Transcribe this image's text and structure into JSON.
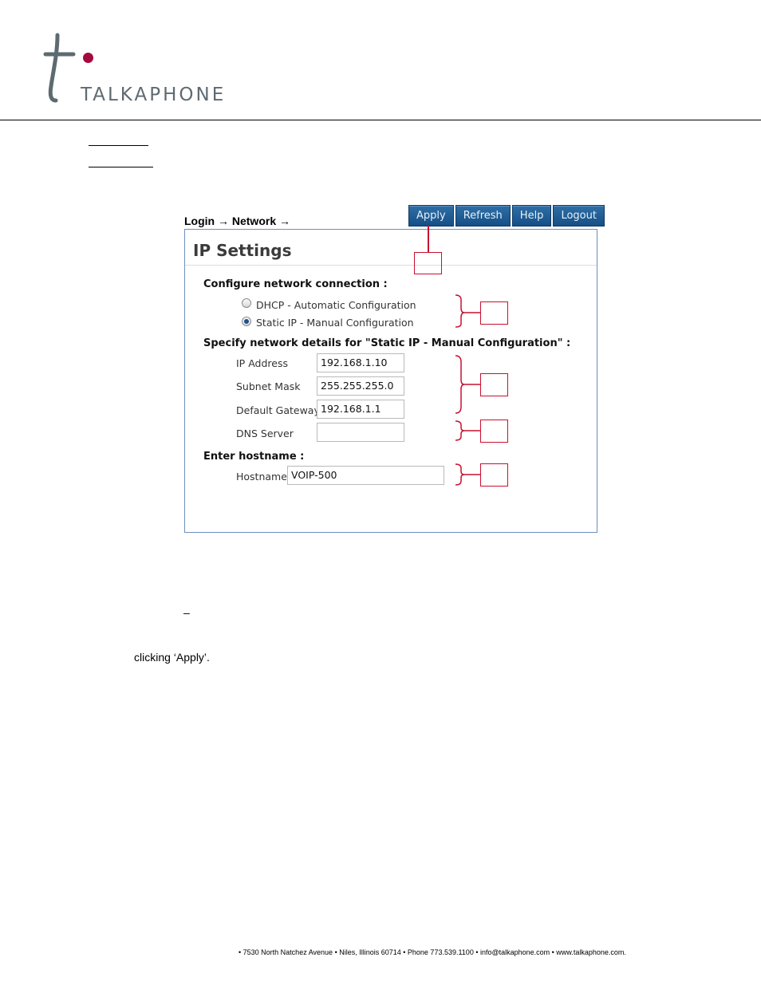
{
  "brand": {
    "name": "TALKAPHONE",
    "accent": "#a6093d"
  },
  "breadcrumb": "Login → Network →",
  "toolbar": {
    "apply": "Apply",
    "refresh": "Refresh",
    "help": "Help",
    "logout": "Logout",
    "color": "#1e5a93"
  },
  "panel": {
    "title": "IP Settings",
    "connection": {
      "heading": "Configure network connection :",
      "options": [
        {
          "label": "DHCP - Automatic Configuration",
          "selected": false
        },
        {
          "label": "Static IP - Manual Configuration",
          "selected": true
        }
      ]
    },
    "details": {
      "heading": "Specify network details for \"Static IP - Manual Configuration\" :",
      "fields": [
        {
          "label": "IP Address",
          "value": "192.168.1.10"
        },
        {
          "label": "Subnet Mask",
          "value": "255.255.255.0"
        },
        {
          "label": "Default Gateway",
          "value": "192.168.1.1"
        },
        {
          "label": "DNS Server",
          "value": ""
        }
      ]
    },
    "hostname": {
      "heading": "Enter hostname :",
      "label": "Hostname",
      "value": "VOIP-500"
    }
  },
  "dash": "–",
  "body_text": "clicking ‘Apply’.",
  "footer": "• 7530 North Natchez Avenue • Niles, Illinois 60714 • Phone 773.539.1100 • info@talkaphone.com • www.talkaphone.com."
}
